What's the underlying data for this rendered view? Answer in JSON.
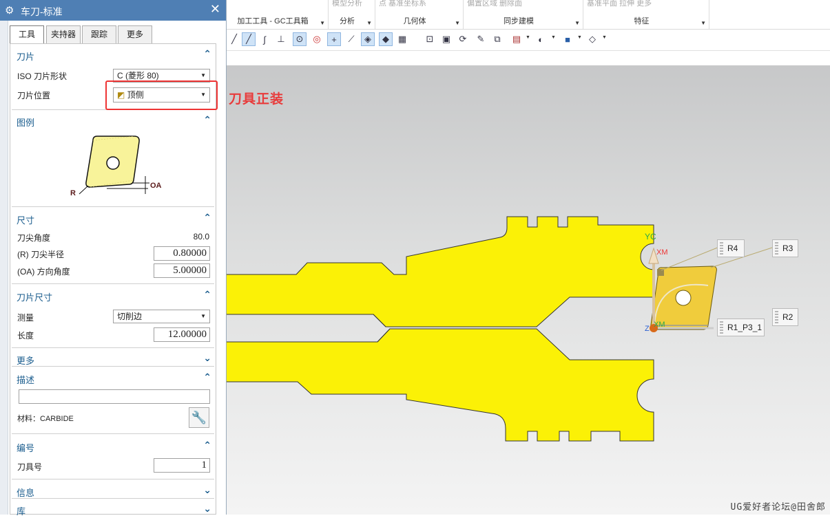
{
  "dialog": {
    "title": "车刀-标准",
    "tabs": [
      "工具",
      "夹持器",
      "跟踪",
      "更多"
    ],
    "active_tab": "工具",
    "insert_section": {
      "title": "刀片",
      "iso_shape_label": "ISO 刀片形状",
      "iso_shape_value": "C (菱形 80)",
      "position_label": "刀片位置",
      "position_value": "顶侧"
    },
    "legend_section": {
      "title": "图例",
      "r_label": "R",
      "oa_label": "OA"
    },
    "dimensions_section": {
      "title": "尺寸",
      "nose_angle_label": "刀尖角度",
      "nose_angle_value": "80.0",
      "nose_radius_label": "(R) 刀尖半径",
      "nose_radius_value": "0.80000",
      "orient_angle_label": "(OA) 方向角度",
      "orient_angle_value": "5.00000"
    },
    "insert_size_section": {
      "title": "刀片尺寸",
      "measure_label": "测量",
      "measure_value": "切削边",
      "length_label": "长度",
      "length_value": "12.00000"
    },
    "more_section": {
      "title": "更多"
    },
    "description_section": {
      "title": "描述",
      "description_value": "",
      "material_label": "材料：CARBIDE"
    },
    "number_section": {
      "title": "编号",
      "tool_number_label": "刀具号",
      "tool_number_value": "1"
    },
    "info_section": {
      "title": "信息"
    },
    "library_section": {
      "title": "库"
    }
  },
  "ribbon": {
    "groups": [
      {
        "name": "加工工具 - GC工具箱",
        "top": ""
      },
      {
        "name": "分析",
        "top": "模型分析"
      },
      {
        "name": "几何体",
        "top": "点    基准坐标系"
      },
      {
        "name": "同步建模",
        "top": "偏置区域    删除面"
      },
      {
        "name": "特征",
        "top": "基准平面    拉伸    更多"
      }
    ]
  },
  "graphics": {
    "annotation": "刀具正装",
    "labels": [
      "R4",
      "R3",
      "R2",
      "R1_P3_1"
    ],
    "axis_labels": {
      "yc": "YC",
      "xm": "XM",
      "xm2": "XM",
      "zc": "Z"
    },
    "watermark": "UG爱好者论坛@田舍郎"
  },
  "colors": {
    "title_bar": "#4f7fb4",
    "part_fill": "#fbf106",
    "insert_fill": "#f0cc3c",
    "annotation_red": "#e83b3b",
    "section_title": "#1b5d8e"
  }
}
